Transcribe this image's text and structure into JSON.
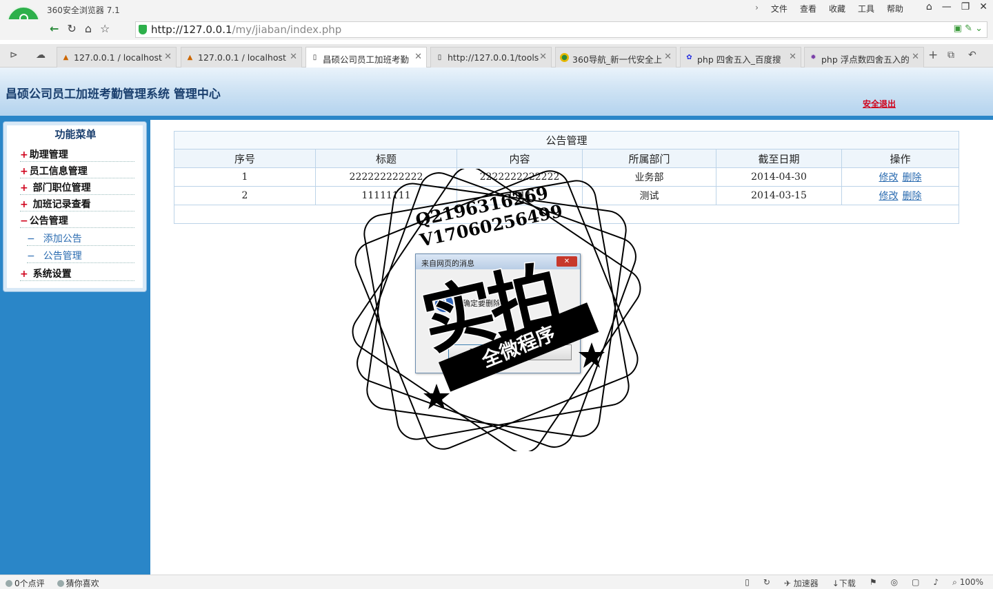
{
  "browser": {
    "title": "360安全浏览器 7.1",
    "menus": [
      "文件",
      "查看",
      "收藏",
      "工具",
      "帮助"
    ],
    "url_host": "http://127.0.0.1",
    "url_path": "/my/jiaban/index.php",
    "tabs": [
      {
        "label": "127.0.0.1 / localhost"
      },
      {
        "label": "127.0.0.1 / localhost"
      },
      {
        "label": "昌硕公司员工加班考勤"
      },
      {
        "label": "http://127.0.0.1/tools"
      },
      {
        "label": "360导航_新一代安全上"
      },
      {
        "label": "php 四舍五入_百度搜"
      },
      {
        "label": "php 浮点数四舍五入的"
      }
    ],
    "status": {
      "comments": "0个点评",
      "guess": "猜你喜欢",
      "accelerator": "加速器",
      "download": "下载",
      "zoom": "100%"
    }
  },
  "header": {
    "title": "昌硕公司员工加班考勤管理系统 管理中心",
    "logout": "安全退出"
  },
  "sidebar": {
    "title": "功能菜单",
    "items": [
      {
        "sign": "+",
        "label": "助理管理"
      },
      {
        "sign": "+",
        "label": "员工信息管理"
      },
      {
        "sign": "+",
        "label": "部门职位管理"
      },
      {
        "sign": "+",
        "label": "加班记录查看"
      },
      {
        "sign": "−",
        "label": "公告管理"
      },
      {
        "sign": "+",
        "label": "系统设置"
      }
    ],
    "subitems": [
      {
        "label": "添加公告"
      },
      {
        "label": "公告管理"
      }
    ]
  },
  "table": {
    "caption": "公告管理",
    "headers": [
      "序号",
      "标题",
      "内容",
      "所属部门",
      "截至日期",
      "操作"
    ],
    "rows": [
      {
        "id": "1",
        "title": "222222222222",
        "content": "2222222222222",
        "dept": "业务部",
        "date": "2014-04-30",
        "edit": "修改",
        "delete": "删除"
      },
      {
        "id": "2",
        "title": "11111111",
        "content": "1111",
        "dept": "测试",
        "date": "2014-03-15",
        "edit": "修改",
        "delete": "删除"
      }
    ]
  },
  "dialog": {
    "title": "来自网页的消息",
    "message": "确定要删除吗",
    "ok": "确定"
  },
  "watermark": {
    "line1": "Q2196316269",
    "line2": "V17060256499",
    "big": "实拍",
    "banner": "全微程序"
  },
  "colors": {
    "sidebar": "#2a86c8",
    "logout": "#d0021b",
    "link": "#2a6bb0"
  }
}
